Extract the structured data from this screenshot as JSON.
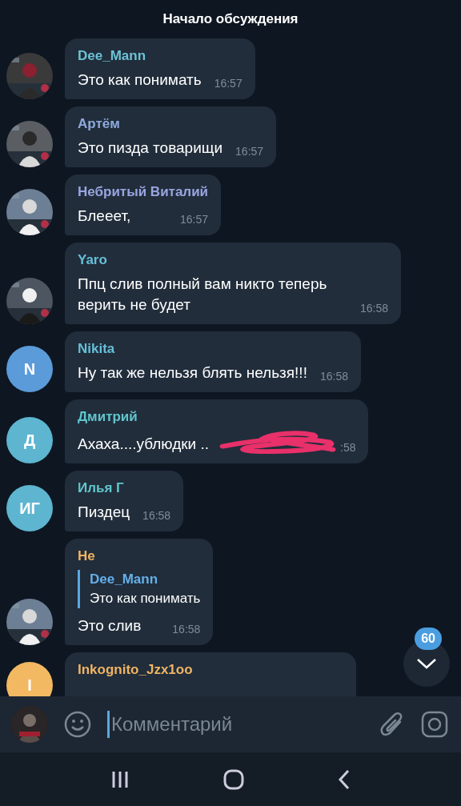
{
  "header": {
    "title": "Начало обсуждения"
  },
  "messages": [
    {
      "author": "Dee_Mann",
      "color": "#6cc3d5",
      "text": "Это как понимать",
      "time": "16:57"
    },
    {
      "author": "Артём",
      "color": "#8eaadb",
      "text": "Это пизда товарищи",
      "time": "16:57"
    },
    {
      "author": "Небритый Виталий",
      "color": "#9aa5e0",
      "text": "Блееет,",
      "time": "16:57"
    },
    {
      "author": "Yaro",
      "color": "#66bfd8",
      "text": "Ппц слив полный вам никто теперь верить не будет",
      "time": "16:58"
    },
    {
      "author": "Nikita",
      "color": "#66bfd8",
      "avatar": {
        "kind": "initials",
        "initials": "N",
        "color": "#5b9bd9"
      },
      "text": "Ну так же нельзя блять нельзя!!!",
      "time": "16:58"
    },
    {
      "author": "Дмитрий",
      "color": "#5fc6cc",
      "avatar": {
        "kind": "initials",
        "initials": "Д",
        "color": "#5db5d0"
      },
      "text": "Ахаха....ублюдки ..",
      "redacted": true,
      "time": ":58"
    },
    {
      "author": "Илья Г",
      "color": "#5fc6cc",
      "avatar": {
        "kind": "initials",
        "initials": "ИГ",
        "color": "#5db5d0"
      },
      "text": "Пиздец",
      "time": "16:58"
    },
    {
      "author": "Не",
      "color": "#f0b464",
      "reply": {
        "author": "Dee_Mann",
        "text": "Это как понимать"
      },
      "text": "Это слив",
      "time": "16:58"
    },
    {
      "author": "Inkognito_Jzx1oo",
      "color": "#f0b464",
      "avatar": {
        "kind": "initials",
        "initials": "I",
        "color": "#f2b862"
      }
    }
  ],
  "scroll_down": {
    "badge": "60"
  },
  "composer": {
    "placeholder": "Комментарий"
  }
}
